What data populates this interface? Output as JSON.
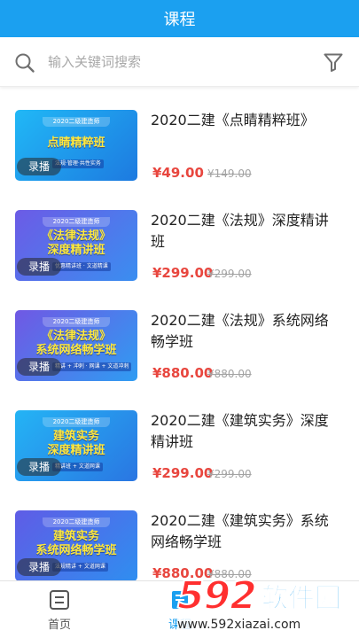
{
  "header": {
    "title": "课程"
  },
  "search": {
    "placeholder": "输入关键词搜索"
  },
  "courses": [
    {
      "title": "2020二建《点睛精粹班》",
      "price": "¥49.00",
      "original_price": "¥149.00",
      "badge": "录播",
      "thumb": {
        "banner": "2020二级建造师",
        "lines": [
          "点睛精粹班"
        ],
        "sub": "法规·管理·共性实务",
        "colors": [
          "#21b8f6",
          "#1d7ae0"
        ]
      }
    },
    {
      "title": "2020二建《法规》深度精讲班",
      "price": "¥299.00",
      "original_price": "¥299.00",
      "badge": "录播",
      "thumb": {
        "banner": "2020二级建造师",
        "lines": [
          "《法律法规》",
          "深度精讲班"
        ],
        "sub": "优惠精讲班 · 文道精课",
        "colors": [
          "#6c5be6",
          "#3a8ef0"
        ]
      }
    },
    {
      "title": "2020二建《法规》系统网络畅学班",
      "price": "¥880.00",
      "original_price": "¥880.00",
      "badge": "录播",
      "thumb": {
        "banner": "2020二级建造师",
        "lines": [
          "《法律法规》",
          "系统网络畅学班"
        ],
        "sub": "精讲 + 冲刺 · 网课 + 文道冲刺",
        "colors": [
          "#7058e4",
          "#2f9cf2"
        ]
      }
    },
    {
      "title": "2020二建《建筑实务》深度精讲班",
      "price": "¥299.00",
      "original_price": "¥299.00",
      "badge": "录播",
      "thumb": {
        "banner": "2020二级建造师",
        "lines": [
          "建筑实务",
          "深度精讲班"
        ],
        "sub": "精讲班 + 文道网课",
        "colors": [
          "#24b4f5",
          "#2a76e2"
        ]
      }
    },
    {
      "title": "2020二建《建筑实务》系统网络畅学班",
      "price": "¥880.00",
      "original_price": "¥880.00",
      "badge": "录播",
      "thumb": {
        "banner": "2020二级建造师",
        "lines": [
          "建筑实务",
          "系统网络畅学班"
        ],
        "sub": "法规精讲 + 文道网课",
        "colors": [
          "#5f5ce6",
          "#2f8ef0"
        ]
      }
    }
  ],
  "tabbar": {
    "tabs": [
      {
        "label": "首页"
      },
      {
        "label": "课程"
      }
    ]
  },
  "watermark": {
    "number": "592",
    "text": "软件园",
    "url": "www.592xiazai.com"
  },
  "colors": {
    "primary": "#1ba0f0",
    "price": "#e8463e",
    "muted": "#a3a3a3"
  }
}
